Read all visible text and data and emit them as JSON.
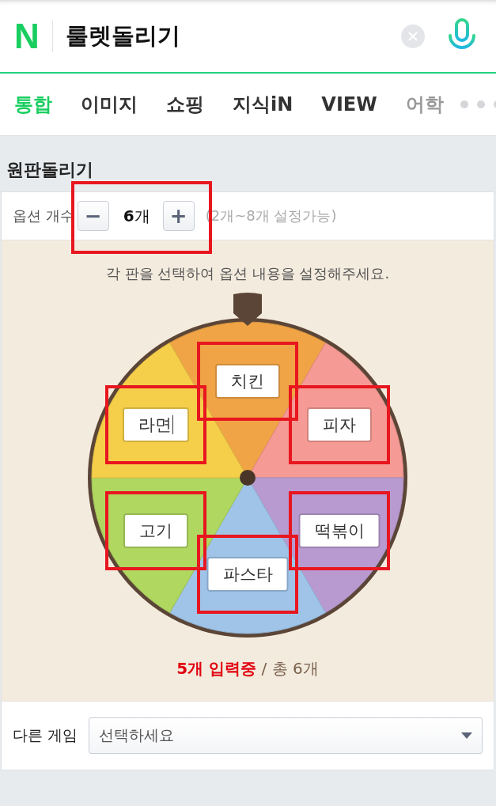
{
  "header": {
    "logo": "N",
    "query": "룰렛돌리기"
  },
  "tabs": [
    {
      "label": "통합",
      "selected": true
    },
    {
      "label": "이미지",
      "selected": false
    },
    {
      "label": "쇼핑",
      "selected": false
    },
    {
      "label": "지식iN",
      "selected": false
    },
    {
      "label": "VIEW",
      "selected": false
    },
    {
      "label": "어학",
      "selected": false,
      "faded": true
    }
  ],
  "section_title": "원판돌리기",
  "option_count": {
    "label": "옵션 개수",
    "minus": "−",
    "value": "**6**개",
    "plus": "+",
    "hint": "(2개~8개 설정가능)",
    "highlighted": true
  },
  "instruction": "각 판을 선택하여 옵션 내용을 설정해주세요.",
  "options": [
    {
      "text": "치킨",
      "color": "#f0a445",
      "highlighted": true,
      "editing": false
    },
    {
      "text": "피자",
      "color": "#f59a94",
      "highlighted": true,
      "editing": false
    },
    {
      "text": "떡볶이",
      "color": "#b99ad0",
      "highlighted": true,
      "editing": false
    },
    {
      "text": "파스타",
      "color": "#9fc4e8",
      "highlighted": true,
      "editing": false
    },
    {
      "text": "고기",
      "color": "#b0d760",
      "highlighted": true,
      "editing": false
    },
    {
      "text": "라면",
      "color": "#f5cf4a",
      "highlighted": true,
      "editing": true
    }
  ],
  "status": "**5개 입력중** / 총 6개",
  "other_game": {
    "label": "다른 게임",
    "placeholder": "선택하세요"
  }
}
